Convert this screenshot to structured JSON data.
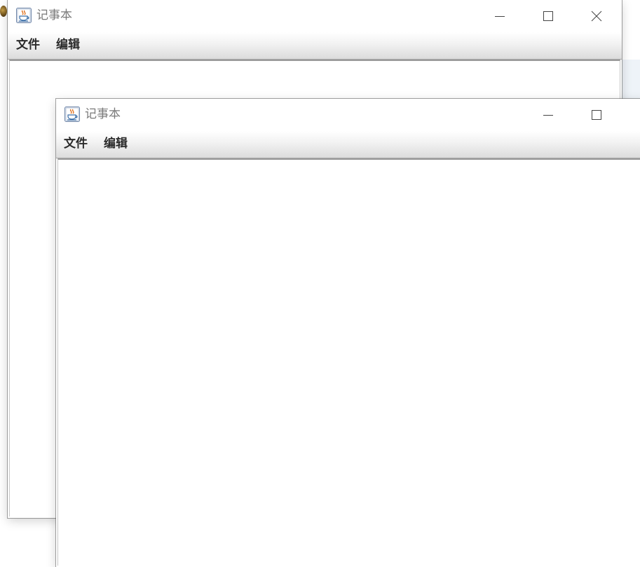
{
  "desktop": {
    "accent_color": "#1f6aa5"
  },
  "windows": [
    {
      "title": "记事本",
      "icon": "java-cup-icon",
      "menus": [
        {
          "label": "文件"
        },
        {
          "label": "编辑"
        }
      ],
      "controls": [
        "minimize-icon",
        "maximize-icon",
        "close-icon"
      ],
      "editor_text": ""
    },
    {
      "title": "记事本",
      "icon": "java-cup-icon",
      "menus": [
        {
          "label": "文件"
        },
        {
          "label": "编辑"
        }
      ],
      "controls": [
        "minimize-icon",
        "maximize-icon"
      ],
      "editor_text": ""
    }
  ]
}
